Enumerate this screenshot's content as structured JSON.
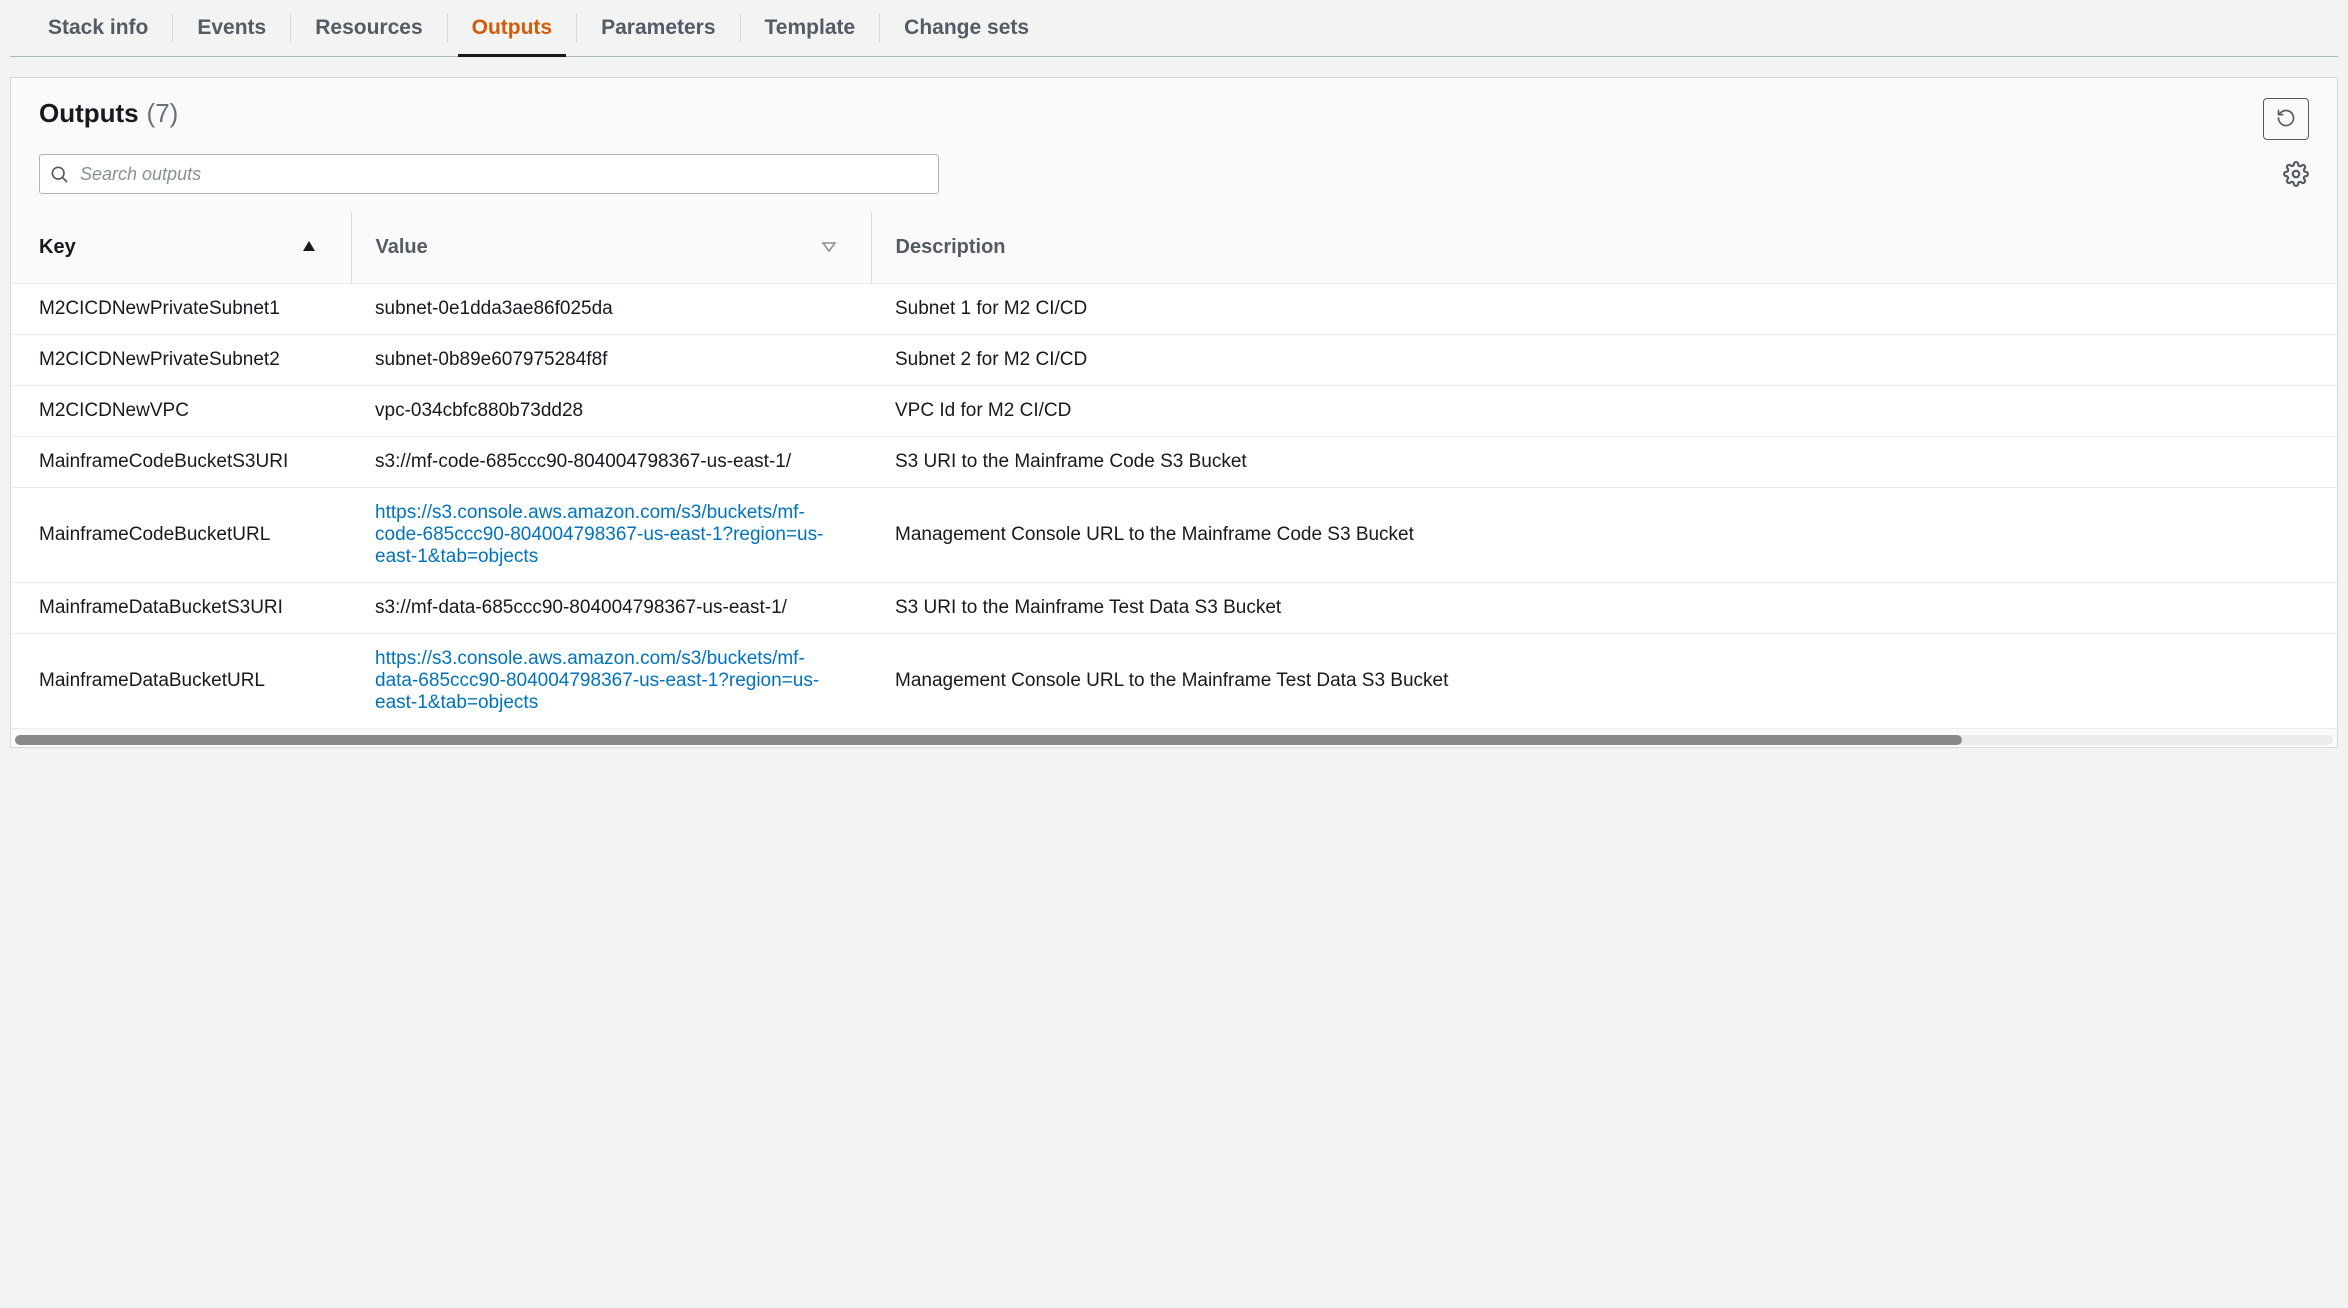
{
  "tabs": [
    {
      "id": "stack-info",
      "label": "Stack info",
      "active": false
    },
    {
      "id": "events",
      "label": "Events",
      "active": false
    },
    {
      "id": "resources",
      "label": "Resources",
      "active": false
    },
    {
      "id": "outputs",
      "label": "Outputs",
      "active": true
    },
    {
      "id": "parameters",
      "label": "Parameters",
      "active": false
    },
    {
      "id": "template",
      "label": "Template",
      "active": false
    },
    {
      "id": "change-sets",
      "label": "Change sets",
      "active": false
    }
  ],
  "panel": {
    "title": "Outputs",
    "count": "(7)",
    "search_placeholder": "Search outputs"
  },
  "columns": {
    "key": "Key",
    "value": "Value",
    "description": "Description"
  },
  "rows": [
    {
      "key": "M2CICDNewPrivateSubnet1",
      "value": "subnet-0e1dda3ae86f025da",
      "is_link": false,
      "description": "Subnet 1 for M2 CI/CD"
    },
    {
      "key": "M2CICDNewPrivateSubnet2",
      "value": "subnet-0b89e607975284f8f",
      "is_link": false,
      "description": "Subnet 2 for M2 CI/CD"
    },
    {
      "key": "M2CICDNewVPC",
      "value": "vpc-034cbfc880b73dd28",
      "is_link": false,
      "description": "VPC Id for M2 CI/CD"
    },
    {
      "key": "MainframeCodeBucketS3URI",
      "value": "s3://mf-code-685ccc90-804004798367-us-east-1/",
      "is_link": false,
      "description": "S3 URI to the Mainframe Code S3 Bucket"
    },
    {
      "key": "MainframeCodeBucketURL",
      "value": "https://s3.console.aws.amazon.com/s3/buckets/mf-code-685ccc90-804004798367-us-east-1?region=us-east-1&tab=objects",
      "is_link": true,
      "description": "Management Console URL to the Mainframe Code S3 Bucket"
    },
    {
      "key": "MainframeDataBucketS3URI",
      "value": "s3://mf-data-685ccc90-804004798367-us-east-1/",
      "is_link": false,
      "description": "S3 URI to the Mainframe Test Data S3 Bucket"
    },
    {
      "key": "MainframeDataBucketURL",
      "value": "https://s3.console.aws.amazon.com/s3/buckets/mf-data-685ccc90-804004798367-us-east-1?region=us-east-1&tab=objects",
      "is_link": true,
      "description": "Management Console URL to the Mainframe Test Data S3 Bucket"
    }
  ]
}
